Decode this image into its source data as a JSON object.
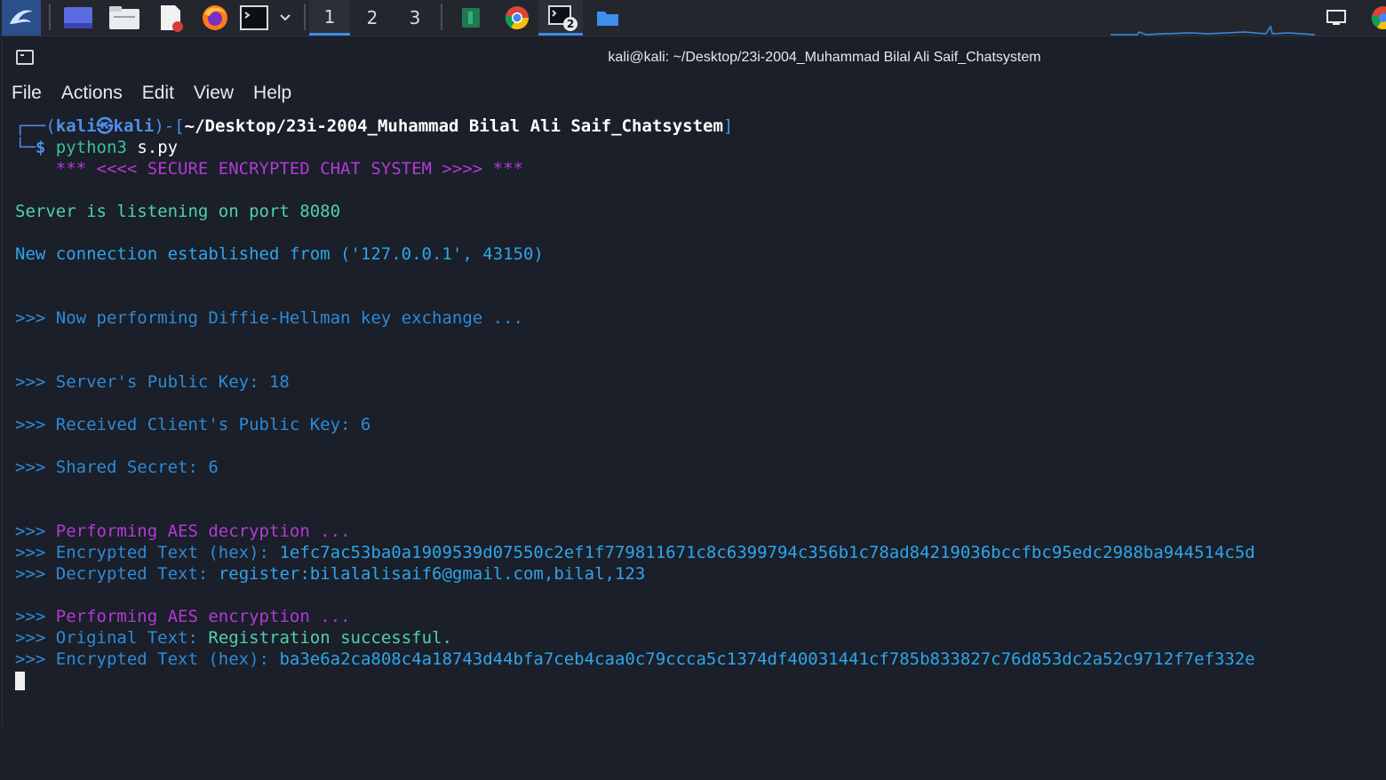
{
  "taskbar": {
    "workspaces": [
      "1",
      "2",
      "3"
    ],
    "terminal_badge": "2",
    "colors": {
      "bg": "#23262d",
      "accent": "#3c8ce7"
    },
    "icons": [
      "kali-dragon-icon",
      "desktop-icon",
      "file-manager-icon",
      "text-editor-icon",
      "firefox-icon",
      "terminal-icon",
      "chevron-down-icon",
      "app-green-icon",
      "chrome-icon",
      "terminal-active-icon",
      "folder-icon",
      "display-icon",
      "chrome-icon-2"
    ]
  },
  "window": {
    "title": "kali@kali: ~/Desktop/23i-2004_Muhammad Bilal Ali Saif_Chatsystem",
    "menu": [
      "File",
      "Actions",
      "Edit",
      "View",
      "Help"
    ]
  },
  "terminal": {
    "prompt": {
      "open": "┌──(",
      "user": "kali",
      "at": "㉿",
      "host": "kali",
      "mid": ")-[",
      "path": "~/Desktop/23i-2004_Muhammad Bilal Ali Saif_Chatsystem",
      "close": "]",
      "dollar_prefix": "└─",
      "dollar": "$",
      "cmd": "python3",
      "arg": "s.py"
    },
    "banner": "    *** <<<< SECURE ENCRYPTED CHAT SYSTEM >>>> ***",
    "listening": "Server is listening on port 8080",
    "connection": "New connection established from ('127.0.0.1', 43150)",
    "dh": ">>> Now performing Diffie-Hellman key exchange ...",
    "server_pub": ">>> Server's Public Key: 18",
    "client_pub": ">>> Received Client's Public Key: 6",
    "shared": ">>> Shared Secret: 6",
    "aes_dec_label": "Performing AES decryption ...",
    "enc_hex_label": "Encrypted Text (hex):",
    "enc_hex_value": "1efc7ac53ba0a1909539d07550c2ef1f779811671c8c6399794c356b1c78ad84219036bccfbc95edc2988ba944514c5d",
    "dec_label": "Decrypted Text:",
    "dec_value": "register:bilalalisaif6@gmail.com,bilal,123",
    "aes_enc_label": "Performing AES encryption ...",
    "orig_label": "Original Text:",
    "orig_value": "Registration successful.",
    "enc2_label": "Encrypted Text (hex):",
    "enc2_value": "ba3e6a2ca808c4a18743d44bfa7ceb4caa0c79ccca5c1374df40031441cf785b833827c76d853dc2a52c9712f7ef332e",
    "chevrons": ">>>"
  }
}
